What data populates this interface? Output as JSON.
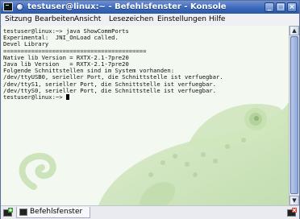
{
  "window": {
    "title": "testuser@linux:~ - Befehlsfenster - Konsole",
    "icons": {
      "app": "terminal-icon",
      "pin": "pin-icon",
      "minimize": "minimize-icon",
      "maximize": "maximize-icon",
      "close": "close-icon"
    },
    "buttons": {
      "minimize_glyph": "_",
      "maximize_glyph": "□",
      "close_glyph": "×"
    },
    "accent_color": "#3d69bb"
  },
  "menubar": {
    "items": [
      "Sitzung",
      "Bearbeiten",
      "Ansicht",
      "Lesezeichen",
      "Einstellungen",
      "Hilfe"
    ]
  },
  "terminal": {
    "lines": [
      "testuser@linux:~> java ShowCommPorts",
      "Experimental:  JNI_OnLoad called.",
      "Devel Library",
      "=========================================",
      "Native lib Version = RXTX-2.1-7pre20",
      "Java lib Version   = RXTX-2.1-7pre20",
      "Folgende Schnittstellen sind im System vorhanden:",
      "/dev/ttyUSB0, serieller Port, die Schnittstelle ist verfuegbar.",
      "/dev/ttyS1, serieller Port, die Schnittstelle ist verfuegbar.",
      "/dev/ttyS0, serieller Port, die Schnittstelle ist verfuegbar."
    ],
    "prompt": "testuser@linux:~> ",
    "background_color": "#f3f9f1"
  },
  "scrollbar": {
    "up_glyph": "▲",
    "down_glyph": "▼"
  },
  "tabbar": {
    "tabs": [
      {
        "label": "Befehlsfenster",
        "icon": "terminal-icon"
      }
    ],
    "new_tab_icon": "new-session-icon",
    "close_tab_icon": "close-session-icon"
  }
}
